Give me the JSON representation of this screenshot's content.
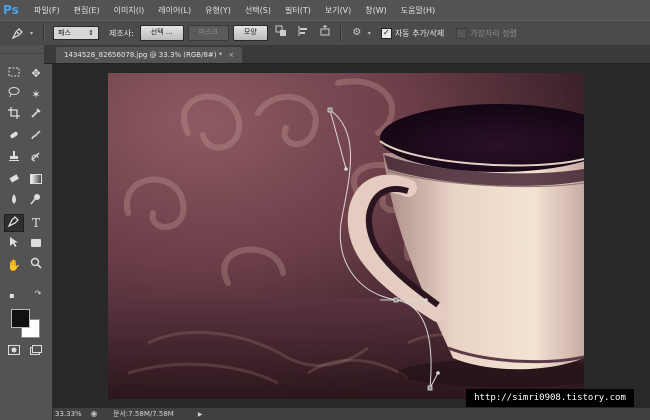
{
  "app": {
    "logo": "Ps"
  },
  "menu": [
    "파일(F)",
    "편집(E)",
    "이미지(I)",
    "레이어(L)",
    "유형(Y)",
    "선택(S)",
    "필터(T)",
    "보기(V)",
    "창(W)",
    "도움말(H)"
  ],
  "options": {
    "mode_value": "패스",
    "make_label": "제조사:",
    "selection_button": "선택 ...",
    "mask_button": "마스크",
    "shape_button": "모양",
    "auto_add_delete_label": "자동 추가/삭제",
    "auto_add_delete_checked": true,
    "align_edges_label": "가장자리 정렬",
    "align_edges_checked": false
  },
  "document": {
    "tab_title": "1434528_82656078.jpg @ 33.3% (RGB/8#) *",
    "tab_close": "×"
  },
  "toolbox": {
    "foreground_color": "#111111",
    "background_color": "#ffffff",
    "tools": [
      "marquee",
      "move",
      "lasso",
      "magic-wand",
      "crop",
      "eyedropper",
      "spot-healing",
      "brush",
      "clone-stamp",
      "history-brush",
      "eraser",
      "gradient",
      "blur",
      "dodge",
      "pen",
      "type",
      "path-selection",
      "shape",
      "hand",
      "zoom"
    ]
  },
  "status": {
    "zoom": "33.33%",
    "doc_info": "문서:7.58M/7.58M"
  },
  "watermark": "http://simri0908.tistory.com",
  "colors": {
    "accent": "#4aa3e8",
    "panel": "#535353",
    "background": "#282828"
  }
}
